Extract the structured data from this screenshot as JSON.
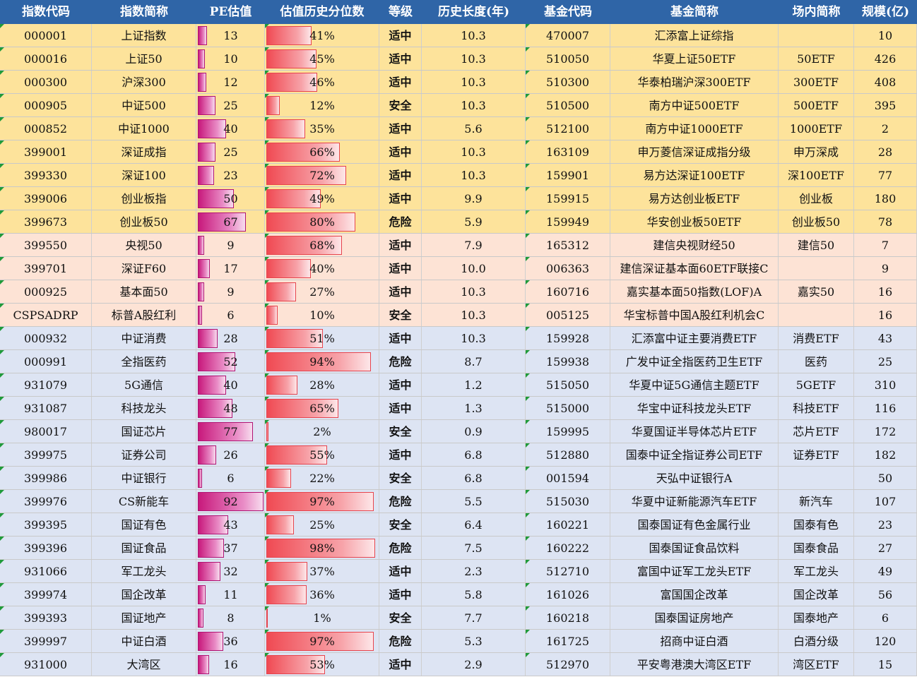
{
  "headers": [
    "指数代码",
    "指数简称",
    "PE估值",
    "估值历史分位数",
    "等级",
    "历史长度(年)",
    "基金代码",
    "基金简称",
    "场内简称",
    "规模(亿)"
  ],
  "colors": {
    "header_bg": "#2f65a7",
    "group_broad": "#fde39b",
    "group_dividend": "#fde3d5",
    "group_sector": "#dde4f3",
    "pe_bar": "#c8197c",
    "percentile_bar": "#f04a53"
  },
  "rows": [
    {
      "index_code": "000001",
      "index_name": "上证指数",
      "pe": 13,
      "pct": 41,
      "pct_label": "41%",
      "level": "适中",
      "years": "10.3",
      "fund_code": "470007",
      "fund_name": "汇添富上证综指",
      "exchange_name": "",
      "scale": "10",
      "group": "broad"
    },
    {
      "index_code": "000016",
      "index_name": "上证50",
      "pe": 10,
      "pct": 45,
      "pct_label": "45%",
      "level": "适中",
      "years": "10.3",
      "fund_code": "510050",
      "fund_name": "华夏上证50ETF",
      "exchange_name": "50ETF",
      "scale": "426",
      "group": "broad"
    },
    {
      "index_code": "000300",
      "index_name": "沪深300",
      "pe": 12,
      "pct": 46,
      "pct_label": "46%",
      "level": "适中",
      "years": "10.3",
      "fund_code": "510300",
      "fund_name": "华泰柏瑞沪深300ETF",
      "exchange_name": "300ETF",
      "scale": "408",
      "group": "broad"
    },
    {
      "index_code": "000905",
      "index_name": "中证500",
      "pe": 25,
      "pct": 12,
      "pct_label": "12%",
      "level": "安全",
      "years": "10.3",
      "fund_code": "510500",
      "fund_name": "南方中证500ETF",
      "exchange_name": "500ETF",
      "scale": "395",
      "group": "broad"
    },
    {
      "index_code": "000852",
      "index_name": "中证1000",
      "pe": 40,
      "pct": 35,
      "pct_label": "35%",
      "level": "适中",
      "years": "5.6",
      "fund_code": "512100",
      "fund_name": "南方中证1000ETF",
      "exchange_name": "1000ETF",
      "scale": "2",
      "group": "broad"
    },
    {
      "index_code": "399001",
      "index_name": "深证成指",
      "pe": 25,
      "pct": 66,
      "pct_label": "66%",
      "level": "适中",
      "years": "10.3",
      "fund_code": "163109",
      "fund_name": "申万菱信深证成指分级",
      "exchange_name": "申万深成",
      "scale": "28",
      "group": "broad"
    },
    {
      "index_code": "399330",
      "index_name": "深证100",
      "pe": 23,
      "pct": 72,
      "pct_label": "72%",
      "level": "适中",
      "years": "10.3",
      "fund_code": "159901",
      "fund_name": "易方达深证100ETF",
      "exchange_name": "深100ETF",
      "scale": "77",
      "group": "broad"
    },
    {
      "index_code": "399006",
      "index_name": "创业板指",
      "pe": 50,
      "pct": 49,
      "pct_label": "49%",
      "level": "适中",
      "years": "9.9",
      "fund_code": "159915",
      "fund_name": "易方达创业板ETF",
      "exchange_name": "创业板",
      "scale": "180",
      "group": "broad"
    },
    {
      "index_code": "399673",
      "index_name": "创业板50",
      "pe": 67,
      "pct": 80,
      "pct_label": "80%",
      "level": "危险",
      "years": "5.9",
      "fund_code": "159949",
      "fund_name": "华安创业板50ETF",
      "exchange_name": "创业板50",
      "scale": "78",
      "group": "broad"
    },
    {
      "index_code": "399550",
      "index_name": "央视50",
      "pe": 9,
      "pct": 68,
      "pct_label": "68%",
      "level": "适中",
      "years": "7.9",
      "fund_code": "165312",
      "fund_name": "建信央视财经50",
      "exchange_name": "建信50",
      "scale": "7",
      "group": "dividend"
    },
    {
      "index_code": "399701",
      "index_name": "深证F60",
      "pe": 17,
      "pct": 40,
      "pct_label": "40%",
      "level": "适中",
      "years": "10.0",
      "fund_code": "006363",
      "fund_name": "建信深证基本面60ETF联接C",
      "exchange_name": "",
      "scale": "9",
      "group": "dividend"
    },
    {
      "index_code": "000925",
      "index_name": "基本面50",
      "pe": 9,
      "pct": 27,
      "pct_label": "27%",
      "level": "适中",
      "years": "10.3",
      "fund_code": "160716",
      "fund_name": "嘉实基本面50指数(LOF)A",
      "exchange_name": "嘉实50",
      "scale": "16",
      "group": "dividend"
    },
    {
      "index_code": "CSPSADRP",
      "index_name": "标普A股红利",
      "pe": 6,
      "pct": 10,
      "pct_label": "10%",
      "level": "安全",
      "years": "10.3",
      "fund_code": "005125",
      "fund_name": "华宝标普中国A股红利机会C",
      "exchange_name": "",
      "scale": "16",
      "group": "dividend"
    },
    {
      "index_code": "000932",
      "index_name": "中证消费",
      "pe": 28,
      "pct": 51,
      "pct_label": "51%",
      "level": "适中",
      "years": "10.3",
      "fund_code": "159928",
      "fund_name": "汇添富中证主要消费ETF",
      "exchange_name": "消费ETF",
      "scale": "43",
      "group": "sector"
    },
    {
      "index_code": "000991",
      "index_name": "全指医药",
      "pe": 52,
      "pct": 94,
      "pct_label": "94%",
      "level": "危险",
      "years": "8.7",
      "fund_code": "159938",
      "fund_name": "广发中证全指医药卫生ETF",
      "exchange_name": "医药",
      "scale": "25",
      "group": "sector"
    },
    {
      "index_code": "931079",
      "index_name": "5G通信",
      "pe": 40,
      "pct": 28,
      "pct_label": "28%",
      "level": "适中",
      "years": "1.2",
      "fund_code": "515050",
      "fund_name": "华夏中证5G通信主题ETF",
      "exchange_name": "5GETF",
      "scale": "310",
      "group": "sector"
    },
    {
      "index_code": "931087",
      "index_name": "科技龙头",
      "pe": 48,
      "pct": 65,
      "pct_label": "65%",
      "level": "适中",
      "years": "1.3",
      "fund_code": "515000",
      "fund_name": "华宝中证科技龙头ETF",
      "exchange_name": "科技ETF",
      "scale": "116",
      "group": "sector"
    },
    {
      "index_code": "980017",
      "index_name": "国证芯片",
      "pe": 77,
      "pct": 2,
      "pct_label": "2%",
      "level": "安全",
      "years": "0.9",
      "fund_code": "159995",
      "fund_name": "华夏国证半导体芯片ETF",
      "exchange_name": "芯片ETF",
      "scale": "172",
      "group": "sector"
    },
    {
      "index_code": "399975",
      "index_name": "证券公司",
      "pe": 26,
      "pct": 55,
      "pct_label": "55%",
      "level": "适中",
      "years": "6.8",
      "fund_code": "512880",
      "fund_name": "国泰中证全指证券公司ETF",
      "exchange_name": "证券ETF",
      "scale": "182",
      "group": "sector"
    },
    {
      "index_code": "399986",
      "index_name": "中证银行",
      "pe": 6,
      "pct": 22,
      "pct_label": "22%",
      "level": "安全",
      "years": "6.8",
      "fund_code": "001594",
      "fund_name": "天弘中证银行A",
      "exchange_name": "",
      "scale": "50",
      "group": "sector"
    },
    {
      "index_code": "399976",
      "index_name": "CS新能车",
      "pe": 92,
      "pct": 97,
      "pct_label": "97%",
      "level": "危险",
      "years": "5.5",
      "fund_code": "515030",
      "fund_name": "华夏中证新能源汽车ETF",
      "exchange_name": "新汽车",
      "scale": "107",
      "group": "sector"
    },
    {
      "index_code": "399395",
      "index_name": "国证有色",
      "pe": 43,
      "pct": 25,
      "pct_label": "25%",
      "level": "安全",
      "years": "6.4",
      "fund_code": "160221",
      "fund_name": "国泰国证有色金属行业",
      "exchange_name": "国泰有色",
      "scale": "23",
      "group": "sector"
    },
    {
      "index_code": "399396",
      "index_name": "国证食品",
      "pe": 37,
      "pct": 98,
      "pct_label": "98%",
      "level": "危险",
      "years": "7.5",
      "fund_code": "160222",
      "fund_name": "国泰国证食品饮料",
      "exchange_name": "国泰食品",
      "scale": "27",
      "group": "sector"
    },
    {
      "index_code": "931066",
      "index_name": "军工龙头",
      "pe": 32,
      "pct": 37,
      "pct_label": "37%",
      "level": "适中",
      "years": "2.3",
      "fund_code": "512710",
      "fund_name": "富国中证军工龙头ETF",
      "exchange_name": "军工龙头",
      "scale": "49",
      "group": "sector"
    },
    {
      "index_code": "399974",
      "index_name": "国企改革",
      "pe": 11,
      "pct": 36,
      "pct_label": "36%",
      "level": "适中",
      "years": "5.8",
      "fund_code": "161026",
      "fund_name": "富国国企改革",
      "exchange_name": "国企改革",
      "scale": "56",
      "group": "sector"
    },
    {
      "index_code": "399393",
      "index_name": "国证地产",
      "pe": 8,
      "pct": 1,
      "pct_label": "1%",
      "level": "安全",
      "years": "7.7",
      "fund_code": "160218",
      "fund_name": "国泰国证房地产",
      "exchange_name": "国泰地产",
      "scale": "6",
      "group": "sector"
    },
    {
      "index_code": "399997",
      "index_name": "中证白酒",
      "pe": 36,
      "pct": 97,
      "pct_label": "97%",
      "level": "危险",
      "years": "5.3",
      "fund_code": "161725",
      "fund_name": "招商中证白酒",
      "exchange_name": "白酒分级",
      "scale": "120",
      "group": "sector"
    },
    {
      "index_code": "931000",
      "index_name": "大湾区",
      "pe": 16,
      "pct": 53,
      "pct_label": "53%",
      "level": "适中",
      "years": "2.9",
      "fund_code": "512970",
      "fund_name": "平安粤港澳大湾区ETF",
      "exchange_name": "湾区ETF",
      "scale": "15",
      "group": "sector"
    }
  ]
}
